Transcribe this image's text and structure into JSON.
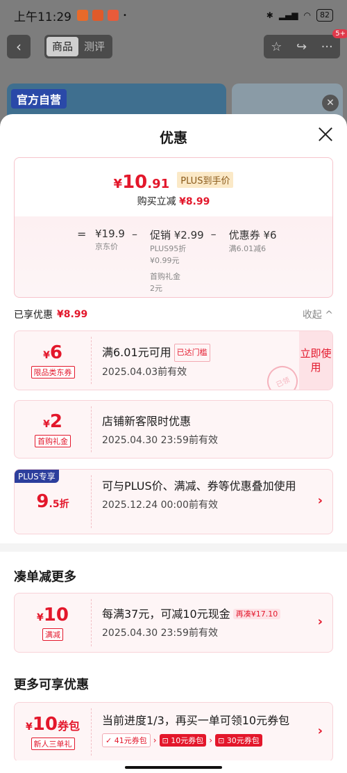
{
  "status_bar": {
    "time": "上午11:29",
    "battery": "82"
  },
  "nav": {
    "tabs": [
      "商品",
      "测评"
    ],
    "active_tab": 0,
    "badge": "5+"
  },
  "banner": {
    "label": "官方自营"
  },
  "sheet": {
    "title": "优惠",
    "summary": {
      "currency": "¥",
      "final_int": "10",
      "final_dec": ".91",
      "plus_tag": "PLUS到手价",
      "bought_label": "购买立减",
      "bought_value": "¥8.99",
      "eq": "=",
      "minus": "–",
      "jd_price": "¥19.9",
      "jd_label": "京东价",
      "promo": "促销 ¥2.99",
      "promo_sub1": "PLUS95折",
      "promo_sub2": "¥0.99元",
      "promo_sub3": "首购礼金",
      "promo_sub4": "2元",
      "coupon": "优惠券 ¥6",
      "coupon_sub": "满6.01减6"
    },
    "enjoyed": {
      "label": "已享优惠",
      "value": "¥8.99",
      "collapse": "收起 ^"
    },
    "coupons": [
      {
        "amount": "6",
        "currency": "¥",
        "tag": "限品类东券",
        "line1": "满6.01元可用",
        "reach": "已达门槛",
        "line2": "2025.04.03前有效",
        "use": "立即使用",
        "stamp": "已领"
      },
      {
        "amount": "2",
        "currency": "¥",
        "tag": "首购礼金",
        "line1": "店铺新客限时优惠",
        "line2": "2025.04.30 23:59前有效"
      },
      {
        "corner": "PLUS专享",
        "amount": "9",
        "dec": ".5折",
        "line1": "可与PLUS价、满减、券等优惠叠加使用",
        "line2": "2025.12.24 00:00前有效"
      }
    ],
    "more_section": {
      "title": "凑单减更多",
      "card": {
        "currency": "¥",
        "amount": "10",
        "tag": "满减",
        "line1": "每满37元，可减10元现金",
        "again": "再凑¥17.10",
        "line2": "2025.04.30 23:59前有效"
      }
    },
    "extra_section": {
      "title": "更多可享优惠",
      "card": {
        "currency": "¥",
        "amount": "10",
        "unit": "券包",
        "tag": "新人三单礼",
        "line1": "当前进度1/3，再买一单可领10元券包",
        "chips": [
          "41元券包",
          "10元券包",
          "30元券包"
        ]
      }
    }
  },
  "colors": {
    "accent": "#e3172b",
    "plus_badge": "#2c3e9c"
  }
}
